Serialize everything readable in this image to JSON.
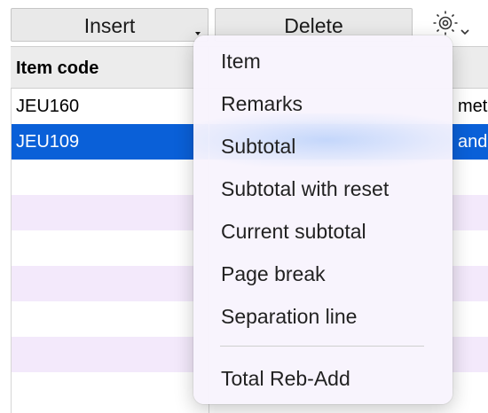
{
  "toolbar": {
    "insert_label": "Insert",
    "delete_label": "Delete",
    "settings_icon": "gear-icon"
  },
  "table": {
    "column1_header": "Item code",
    "rows": [
      {
        "code": "JEU160",
        "col2_visible_text": "mete",
        "selected": false
      },
      {
        "code": "JEU109",
        "col2_visible_text": "and",
        "selected": true
      }
    ]
  },
  "menu": {
    "items": [
      "Item",
      "Remarks",
      "Subtotal",
      "Subtotal with reset",
      "Current subtotal",
      "Page break",
      "Separation line",
      "Total Reb-Add"
    ]
  },
  "colors": {
    "selection": "#0a60d8",
    "row_stripe": "#f3e9fb",
    "menu_background": "#f8f4fd"
  }
}
